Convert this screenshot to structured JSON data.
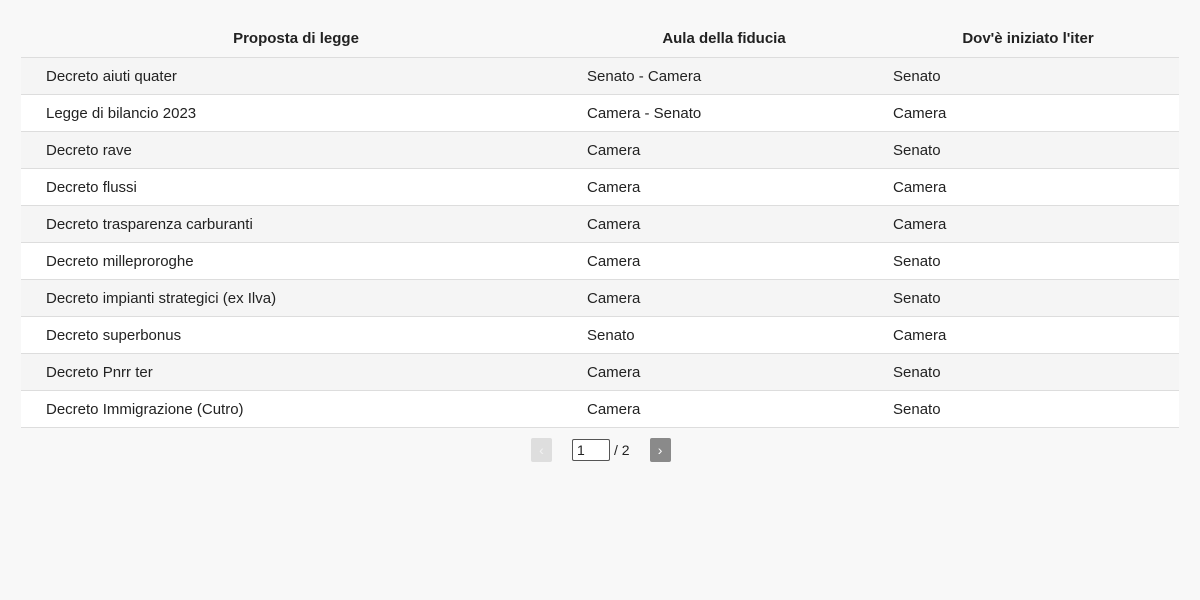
{
  "table": {
    "headers": [
      "Proposta di legge",
      "Aula della fiducia",
      "Dov'è iniziato l'iter"
    ],
    "rows": [
      [
        "Decreto aiuti quater",
        "Senato - Camera",
        "Senato"
      ],
      [
        "Legge di bilancio 2023",
        "Camera - Senato",
        "Camera"
      ],
      [
        "Decreto rave",
        "Camera",
        "Senato"
      ],
      [
        "Decreto flussi",
        "Camera",
        "Camera"
      ],
      [
        "Decreto trasparenza carburanti",
        "Camera",
        "Camera"
      ],
      [
        "Decreto milleproroghe",
        "Camera",
        "Senato"
      ],
      [
        "Decreto impianti strategici (ex Ilva)",
        "Camera",
        "Senato"
      ],
      [
        "Decreto superbonus",
        "Senato",
        "Camera"
      ],
      [
        "Decreto Pnrr ter",
        "Camera",
        "Senato"
      ],
      [
        "Decreto Immigrazione (Cutro)",
        "Camera",
        "Senato"
      ]
    ]
  },
  "pagination": {
    "prev_label": "‹",
    "next_label": "›",
    "current_page": "1",
    "total_text": "/ 2"
  }
}
